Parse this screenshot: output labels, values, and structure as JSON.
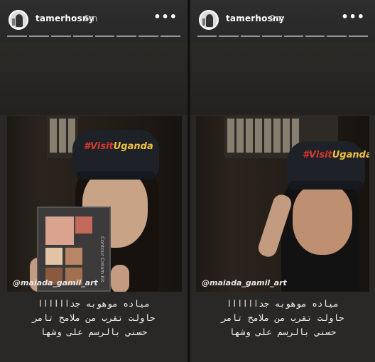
{
  "stories": [
    {
      "username": "tamerhosny",
      "time_ago": "6m",
      "more_label": "•••",
      "progress_segments": 8,
      "cap_text_hashtag": "#Visit",
      "cap_text_brand": "Uganda",
      "palette_label": "Contour Cream Kit",
      "watermark": "@maiada_gamil_art",
      "caption_lines": [
        "مياده موهوبه جداااااا",
        "حاولت تقرب من ملامح تامر",
        "حسني بالرسم على وشها"
      ]
    },
    {
      "username": "tamerhosny",
      "time_ago": "2m",
      "more_label": "•••",
      "progress_segments": 8,
      "cap_text_hashtag": "#Visit",
      "cap_text_brand": "Uganda",
      "watermark": "@maiada_gamil_art",
      "caption_lines": [
        "مياده موهوبه جداااااا",
        "حاولت تقرب من ملامح تامر",
        "حسني بالرسم على وشها"
      ]
    }
  ],
  "colors": {
    "background": "#262626",
    "text": "#ffffff",
    "muted": "#bdbdbd",
    "cap_yellow": "#f1c23d",
    "cap_red": "#d8372d"
  }
}
